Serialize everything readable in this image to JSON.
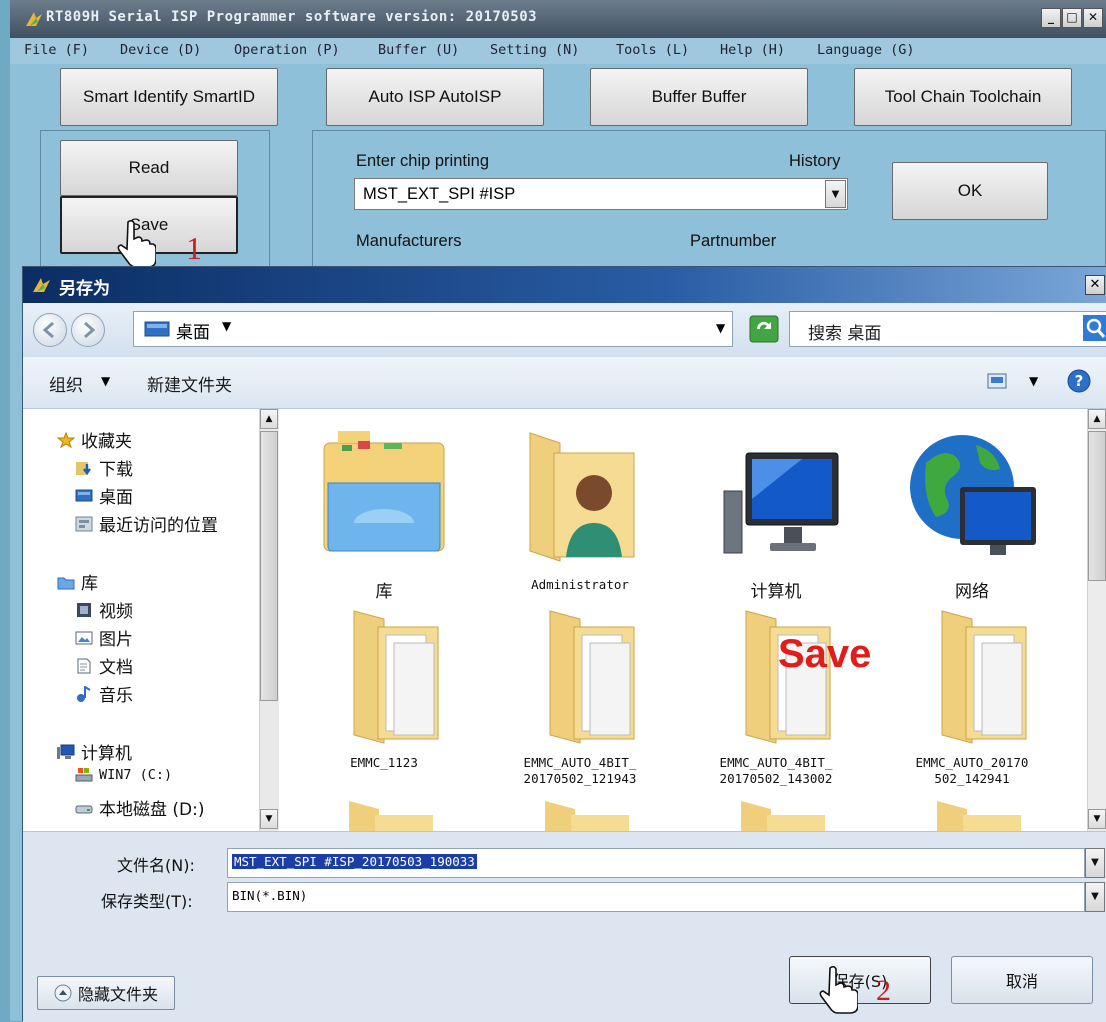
{
  "app": {
    "title": "RT809H Serial ISP Programmer software version: 20170503",
    "menu": [
      "File (F)",
      "Device (D)",
      "Operation (P)",
      "Buffer (U)",
      "Setting (N)",
      "Tools (L)",
      "Help (H)",
      "Language (G)"
    ],
    "top_buttons": [
      "Smart Identify SmartID",
      "Auto ISP AutoISP",
      "Buffer Buffer",
      "Tool Chain Toolchain"
    ],
    "side_buttons": [
      "Read",
      "Save"
    ],
    "chip_label": "Enter chip printing",
    "history_label": "History",
    "chip_value": "MST_EXT_SPI #ISP",
    "ok_label": "OK",
    "manufacturers_label": "Manufacturers",
    "partnumber_label": "Partnumber",
    "step1_label": "1"
  },
  "dialog": {
    "title": "另存为",
    "address": "桌面",
    "search_placeholder": "搜索 桌面",
    "organize_label": "组织",
    "new_folder_label": "新建文件夹",
    "nav": {
      "favorites": "收藏夹",
      "favorites_items": [
        "下载",
        "桌面",
        "最近访问的位置"
      ],
      "libraries": "库",
      "library_items": [
        "视频",
        "图片",
        "文档",
        "音乐"
      ],
      "computer": "计算机",
      "computer_items": [
        "WIN7 (C:)",
        "本地磁盘 (D:)"
      ]
    },
    "files_row1": [
      "库",
      "Administrator",
      "计算机",
      "网络"
    ],
    "files_row2": [
      [
        "EMMC_1123",
        ""
      ],
      [
        "EMMC_AUTO_4BIT_",
        "20170502_121943"
      ],
      [
        "EMMC_AUTO_4BIT_",
        "20170502_143002"
      ],
      [
        "EMMC_AUTO_20170",
        "502_142941"
      ]
    ],
    "filename_label": "文件名(N):",
    "filename_value": "MST_EXT_SPI #ISP_20170503_190033",
    "filetype_label": "保存类型(T):",
    "filetype_value": "BIN(*.BIN)",
    "hide_folders_label": "隐藏文件夹",
    "save_button": "保存(S)",
    "cancel_button": "取消",
    "annotation_save": "Save",
    "step2_label": "2"
  },
  "colors": {
    "app_bg": "#8fc0d9",
    "dialog_title": "#0b2d63",
    "annotation_red": "#e21b1b"
  }
}
